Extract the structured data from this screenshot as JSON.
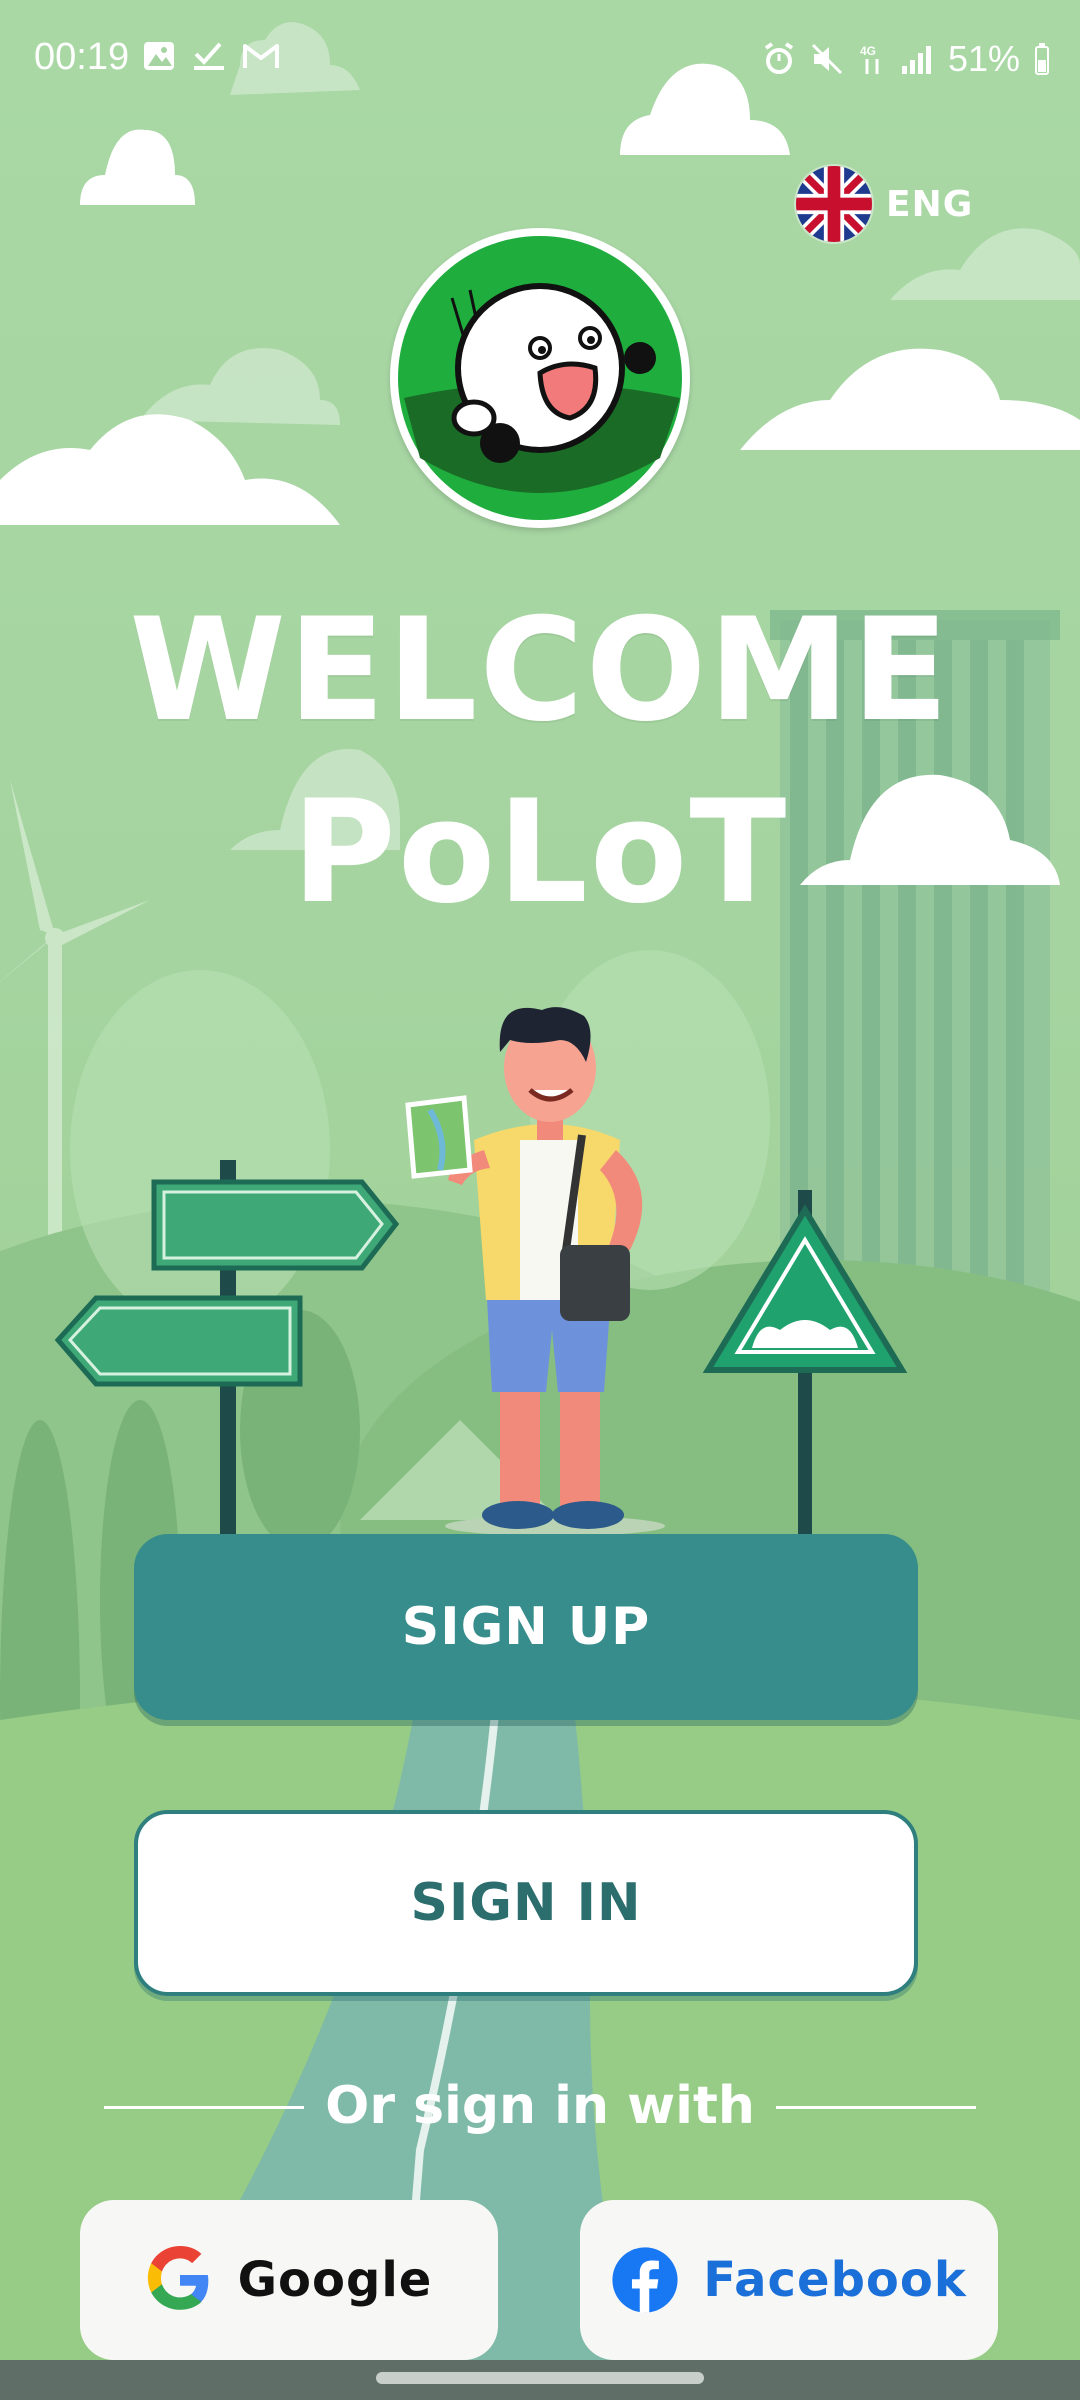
{
  "status_bar": {
    "time": "00:19",
    "battery": "51%",
    "left_icons": [
      "gallery-icon",
      "check-icon",
      "gmail-icon"
    ],
    "right_icons": [
      "alarm-icon",
      "mute-icon",
      "4g-icon",
      "signal-icon",
      "battery-icon"
    ]
  },
  "language": {
    "label": "ENG",
    "flag": "uk-flag-icon"
  },
  "welcome": {
    "line1": "WELCOME",
    "line2": "PoLoT"
  },
  "buttons": {
    "signup": "SIGN UP",
    "signin": "SIGN IN"
  },
  "divider": {
    "text": "Or sign in with"
  },
  "social": {
    "google": "Google",
    "facebook": "Facebook"
  },
  "colors": {
    "background": "#a6d5a1",
    "signup_button": "#378d8c",
    "signin_text": "#2b6e6d",
    "facebook_blue": "#1b6fd8"
  }
}
